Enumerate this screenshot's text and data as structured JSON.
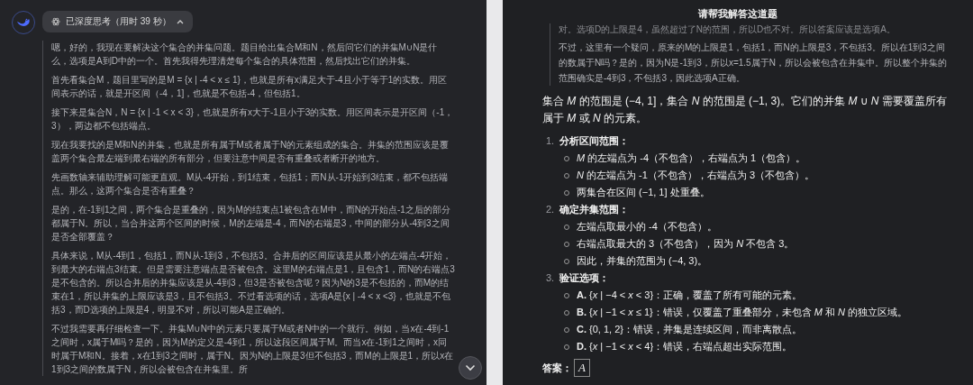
{
  "left_panel": {
    "thinking_toggle": {
      "label": "已深度思考（用时 39 秒）",
      "expanded": true
    },
    "thoughts": [
      "嗯，好的，我现在要解决这个集合的并集问题。题目给出集合M和N，然后问它们的并集M∪N是什么，选项是A到D中的一个。首先我得先理清楚每个集合的具体范围，然后找出它们的并集。",
      "首先看集合M，题目里写的是M = {x | -4 < x ≤ 1}，也就是所有x满足大于-4且小于等于1的实数。用区间表示的话，就是开区间（-4，1]，也就是不包括-4，但包括1。",
      "接下来是集合N，N = {x | -1 < x < 3}，也就是所有x大于-1且小于3的实数。用区间表示是开区间（-1，3），两边都不包括端点。",
      "现在我要找的是M和N的并集，也就是所有属于M或者属于N的元素组成的集合。并集的范围应该是覆盖两个集合最左端到最右端的所有部分，但要注意中间是否有重叠或者断开的地方。",
      "先画数轴来辅助理解可能更直观。M从-4开始，到1结束，包括1；而N从-1开始到3结束，都不包括端点。那么，这两个集合是否有重叠？",
      "是的，在-1到1之间，两个集合是重叠的，因为M的结束点1被包含在M中，而N的开始点-1之后的部分都属于N。所以，当合并这两个区间的时候，M的左端是-4，而N的右端是3，中间的部分从-4到3之间是否全部覆盖？",
      "具体来说，M从-4到1，包括1，而N从-1到3，不包括3。合并后的区间应该是从最小的左端点-4开始，到最大的右端点3结束。但是需要注意端点是否被包含。这里M的右端点是1，且包含1，而N的右端点3是不包含的。所以合并后的并集应该是从-4到3，但3是否被包含呢？因为N的3是不包括的，而M的结束在1，所以并集的上限应该是3，且不包括3。不过看选项的话，选项A是{x | -4 < x <3}，也就是不包括3，而D选项的上限是4，明显不对，所以可能A是正确的。",
      "不过我需要再仔细检查一下。并集M∪N中的元素只要属于M或者N中的一个就行。例如，当x在-4到-1之间时，x属于M吗？是的，因为M的定义是-4到1，所以这段区间属于M。而当x在-1到1之间时，x同时属于M和N。接着，x在1到3之间时，属于N。因为N的上限是3但不包括3，而M的上限是1，所以x在1到3之间的数属于N，所以会被包含在并集里。所"
    ]
  },
  "right_panel": {
    "title": "请帮我解答这道题",
    "faded_thought": "对。选项D的上限是4，虽然超过了N的范围，所以D也不对。所以答案应该是选项A。",
    "thought": "不过，这里有一个疑问，原来的M的上限是1，包括1，而N的上限是3，不包括3。所以在1到3之间的数属于N吗？是的，因为N是-1到3，所以x=1.5属于N，所以会被包含在并集中。所以整个并集的范围确实是-4到3，不包括3，因此选项A正确。",
    "intro": "集合 *M* 的范围是 (−4, 1]，集合 *N* 的范围是 (−1, 3)。它们的并集 *M* ∪ *N* 需要覆盖所有属于 *M* 或 *N* 的元素。",
    "steps": [
      {
        "number": "1.",
        "title": "分析区间范围：",
        "points": [
          "*M* 的左端点为 -4（不包含），右端点为 1（包含）。",
          "*N* 的左端点为 -1（不包含），右端点为 3（不包含）。",
          "两集合在区间 (−1, 1] 处重叠。"
        ]
      },
      {
        "number": "2.",
        "title": "确定并集范围：",
        "points": [
          "左端点取最小的 -4（不包含）。",
          "右端点取最大的 3（不包含），因为 *N* 不包含 3。",
          "因此，并集的范围为 (−4, 3)。"
        ]
      },
      {
        "number": "3.",
        "title": "验证选项：",
        "points": [
          "**A.** {*x* | −4 < *x* < 3}：正确，覆盖了所有可能的元素。",
          "**B.** {*x* | −1 < *x* ≤ 1}：错误，仅覆盖了重叠部分，未包含 *M* 和 *N* 的独立区域。",
          "**C.** {0, 1, 2}：错误，并集是连续区间，而非离散点。",
          "**D.** {*x* | −1 < *x* < 4}：错误，右端点超出实际范围。"
        ]
      }
    ],
    "answer_label": "答案：",
    "answer": "A"
  }
}
